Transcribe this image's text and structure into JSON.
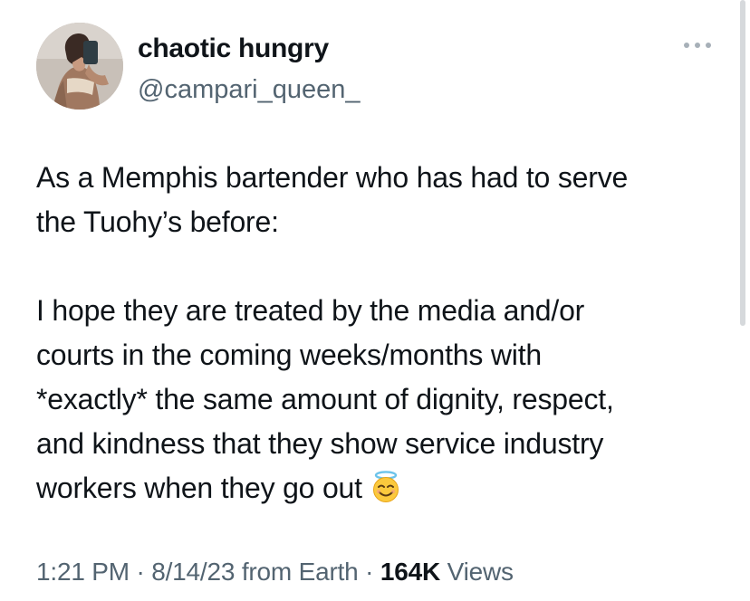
{
  "author": {
    "display_name": "chaotic hungry",
    "handle": "@campari_queen_"
  },
  "tweet": {
    "lines": [
      "As a Memphis bartender who has had to serve",
      "the Tuohy’s before:",
      "I hope they are treated by the media and/or",
      "courts in the coming weeks/months with",
      "*exactly* the same amount of dignity, respect,",
      "and kindness that they show service industry",
      "workers when they go out"
    ],
    "emoji": "smiling-face-with-halo"
  },
  "meta": {
    "time": "1:21 PM",
    "separator": "·",
    "date": "8/14/23",
    "source": "from Earth",
    "views_count": "164K",
    "views_label": "Views"
  },
  "icons": {
    "more": "more-horizontal-icon"
  },
  "colors": {
    "text_primary": "#0f1419",
    "text_secondary": "#536471",
    "more_icon": "#a7b0b8"
  }
}
